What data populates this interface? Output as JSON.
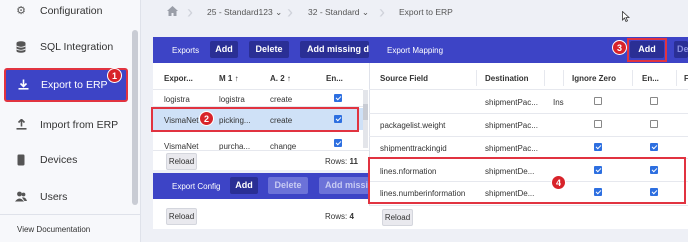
{
  "sidebar": {
    "items": [
      {
        "label": "Configuration",
        "icon": "gear-icon"
      },
      {
        "label": "SQL Integration",
        "icon": "database-icon"
      },
      {
        "label": "Export to ERP",
        "icon": "download-icon",
        "active": true
      },
      {
        "label": "Import from ERP",
        "icon": "upload-icon"
      },
      {
        "label": "Devices",
        "icon": "phone-icon"
      },
      {
        "label": "Users",
        "icon": "users-icon"
      }
    ],
    "footer": "View Documentation"
  },
  "breadcrumb": {
    "item1": "25 - Standard123",
    "item2": "32 - Standard",
    "item3": "Export to ERP"
  },
  "exports": {
    "title": "Exports",
    "add": "Add",
    "delete": "Delete",
    "add_missing": "Add missing det",
    "columns": [
      "Expor...",
      "M 1",
      "A. 2",
      "En..."
    ],
    "rows": [
      {
        "col1": "logistra",
        "col2": "logistra",
        "col3": "create",
        "enabled": true
      },
      {
        "col1": "VismaNet",
        "col2": "picking...",
        "col3": "create",
        "enabled": true
      },
      {
        "col1": "VismaNet",
        "col2": "purcha...",
        "col3": "change",
        "enabled": true
      }
    ],
    "reload": "Reload",
    "rows_label": "Rows:",
    "rows_count": "11"
  },
  "export_config": {
    "title": "Export Config",
    "add": "Add",
    "delete": "Delete",
    "add_missing": "Add missi",
    "reload": "Reload",
    "rows_label": "Rows:",
    "rows_count": "4"
  },
  "export_mapping": {
    "title": "Export Mapping",
    "add": "Add",
    "cut_button": "De",
    "columns": [
      "Source Field",
      "Destination",
      "Ignore Zero",
      "En...",
      "F"
    ],
    "rows": [
      {
        "source": "",
        "destination": "shipmentPac...",
        "extra": "Ins",
        "ignore_zero": false,
        "enabled": false
      },
      {
        "source": "packagelist.weight",
        "destination": "shipmentPac...",
        "extra": "",
        "ignore_zero": false,
        "enabled": false
      },
      {
        "source": "shipmenttrackingid",
        "destination": "shipmentPac...",
        "extra": "",
        "ignore_zero": true,
        "enabled": true
      },
      {
        "source": "lines.nformation",
        "destination": "shipmentDe...",
        "extra": "",
        "ignore_zero": true,
        "enabled": true
      },
      {
        "source": "lines.numberinformation",
        "destination": "shipmentDe...",
        "extra": "",
        "ignore_zero": true,
        "enabled": true
      }
    ],
    "reload": "Reload"
  },
  "callouts": [
    "1",
    "2",
    "3",
    "4"
  ],
  "colors": {
    "accent": "#3d44c6",
    "button_dark": "#2a2f95",
    "callout_red": "#d8232a",
    "checkbox_blue": "#2d6fe0"
  }
}
